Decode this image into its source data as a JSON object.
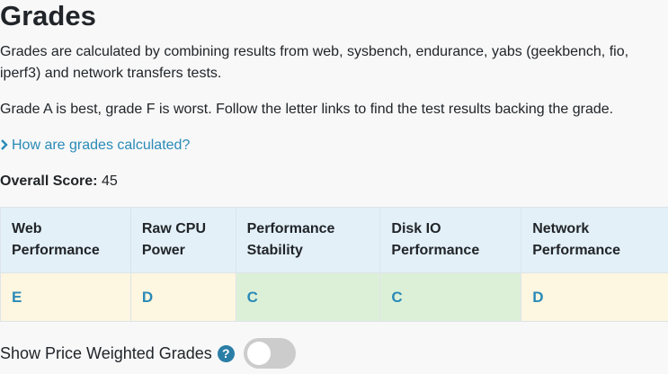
{
  "title": "Grades",
  "intro": "Grades are calculated by combining results from web, sysbench, endurance, yabs (geekbench, fio, iperf3) and network transfers tests.",
  "scale_note": "Grade A is best, grade F is worst. Follow the letter links to find the test results backing the grade.",
  "how_link": "How are grades calculated?",
  "overall": {
    "label": "Overall Score:",
    "value": "45"
  },
  "grades_table": {
    "columns": [
      {
        "header": "Web Performance",
        "grade": "E",
        "status_color": "#fdf6e0"
      },
      {
        "header": "Raw CPU Power",
        "grade": "D",
        "status_color": "#fdf6e0"
      },
      {
        "header": "Performance Stability",
        "grade": "C",
        "status_color": "#dcf0d8"
      },
      {
        "header": "Disk IO Performance",
        "grade": "C",
        "status_color": "#dcf0d8"
      },
      {
        "header": "Network Performance",
        "grade": "D",
        "status_color": "#fdf6e0"
      }
    ]
  },
  "price_weighted": {
    "label": "Show Price Weighted Grades",
    "help_icon": "?",
    "enabled": false
  }
}
